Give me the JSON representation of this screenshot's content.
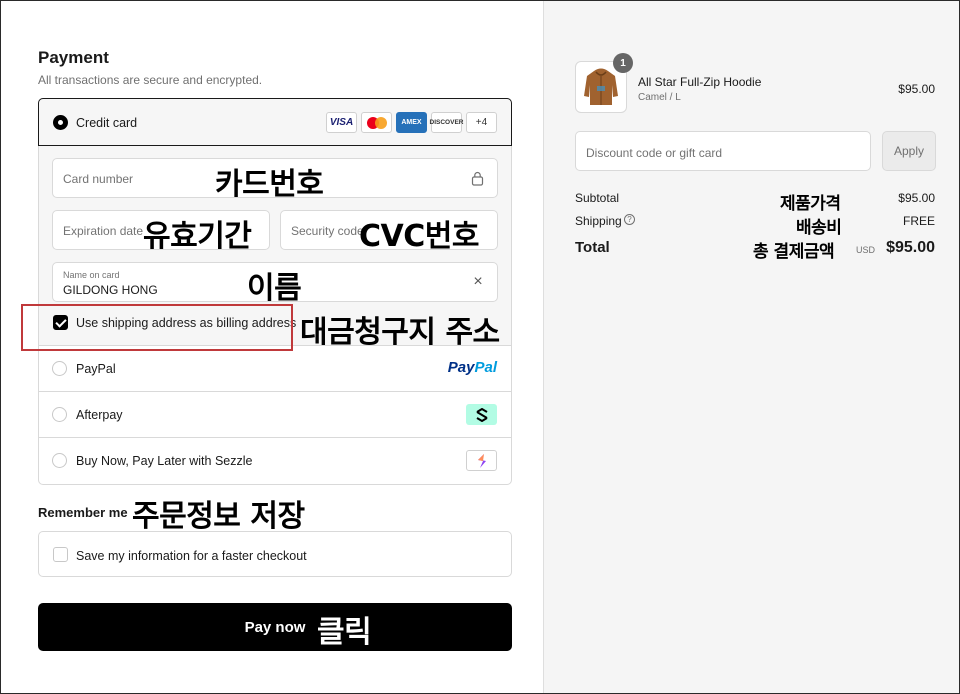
{
  "payment": {
    "title": "Payment",
    "subtitle": "All transactions are secure and encrypted.",
    "credit_card": {
      "label": "Credit card",
      "brands": [
        "VISA",
        "AMEX",
        "DISCOVER",
        "+4"
      ],
      "card_number_placeholder": "Card number",
      "expiration_placeholder": "Expiration date",
      "security_code_placeholder": "Security code",
      "name_label": "Name on card",
      "name_value": "GILDONG HONG",
      "billing_checkbox_label": "Use shipping address as billing address",
      "billing_checked": true
    },
    "other_methods": [
      {
        "label": "PayPal",
        "logo": "paypal-logo"
      },
      {
        "label": "Afterpay",
        "logo": "afterpay-logo"
      },
      {
        "label": "Buy Now, Pay Later with Sezzle",
        "logo": "sezzle-logo"
      }
    ],
    "paypal_logo_parts": [
      "Pay",
      "Pal"
    ]
  },
  "remember": {
    "title": "Remember me",
    "checkbox_label": "Save my information for a faster checkout",
    "checked": false
  },
  "pay_button": {
    "label": "Pay now"
  },
  "annotations": {
    "card_number": "카드번호",
    "expiration": "유효기간",
    "security_code": "CVC번호",
    "name": "이름",
    "billing": "대금청구지 주소",
    "remember": "주문정보 저장",
    "pay": "클릭",
    "product_price": "제품가격",
    "shipping": "배송비",
    "total": "총 결제금액"
  },
  "summary": {
    "product": {
      "name": "All Star Full-Zip Hoodie",
      "variant": "Camel / L",
      "price": "$95.00",
      "quantity": "1"
    },
    "discount_placeholder": "Discount code or gift card",
    "apply_label": "Apply",
    "subtotal_label": "Subtotal",
    "subtotal_value": "$95.00",
    "shipping_label": "Shipping",
    "shipping_value": "FREE",
    "total_label": "Total",
    "total_currency": "USD",
    "total_value": "$95.00"
  },
  "colors": {
    "accent": "#000000",
    "highlight_border": "#c0393b",
    "afterpay_bg": "#b2fce4",
    "paypal_dark": "#003087",
    "paypal_light": "#009cde"
  }
}
